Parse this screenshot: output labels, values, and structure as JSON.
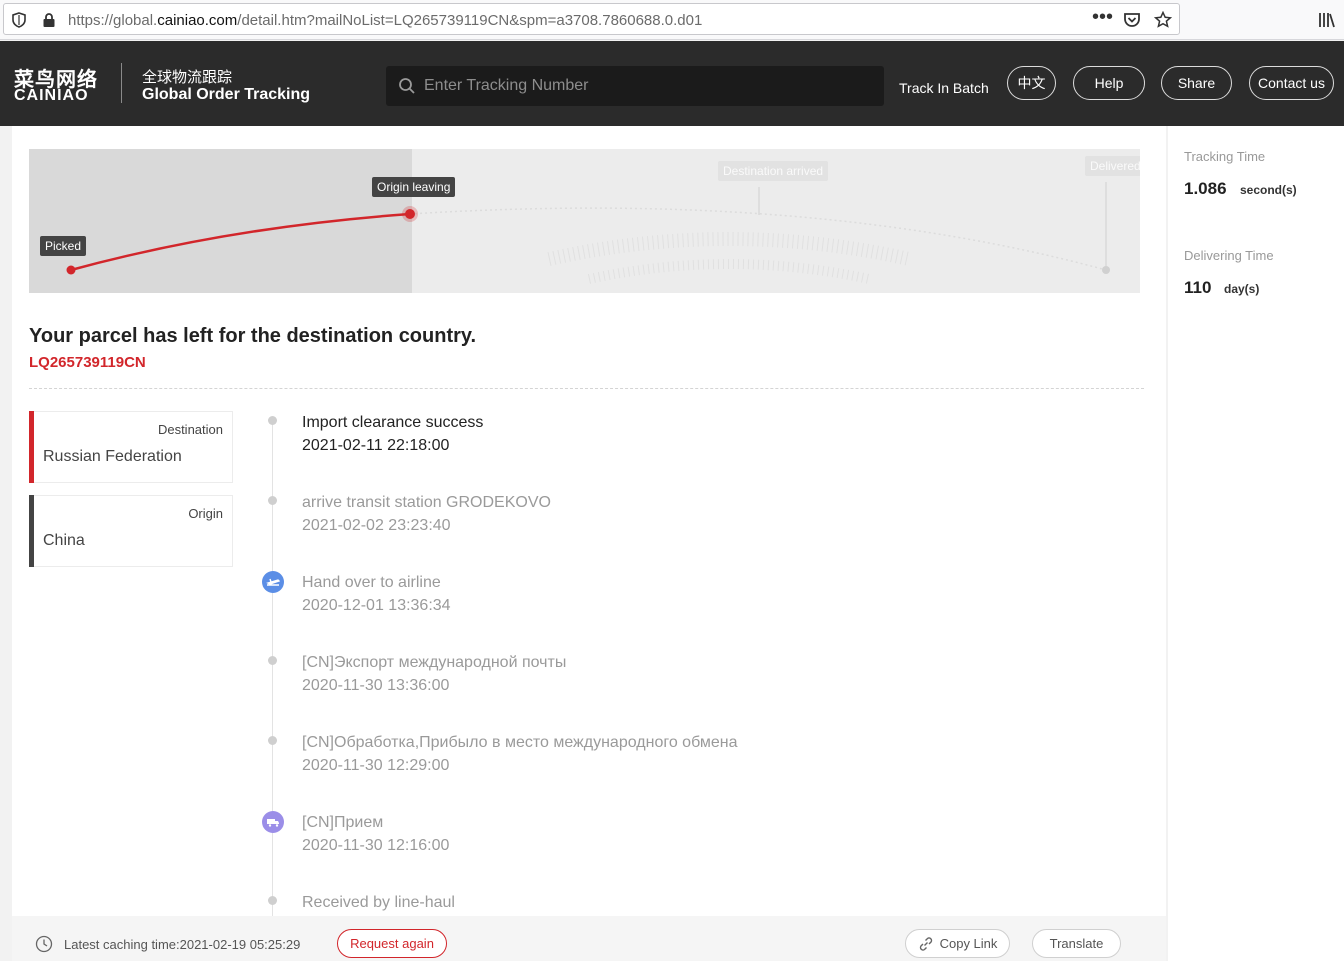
{
  "browser": {
    "url_prefix": "https://global.",
    "url_host": "cainiao.com",
    "url_path": "/detail.htm?mailNoList=LQ265739119CN&spm=a3708.7860688.0.d01"
  },
  "header": {
    "logo_cn": "菜鸟网络",
    "logo_en": "CAINIAO",
    "brand_cn": "全球物流跟踪",
    "brand_en": "Global Order Tracking",
    "search_placeholder": "Enter Tracking Number",
    "track_in_batch": "Track In Batch",
    "lang_button": "中文",
    "help_button": "Help",
    "share_button": "Share",
    "contact_button": "Contact us"
  },
  "progress_map": {
    "stages": [
      "Picked",
      "Origin leaving",
      "Destination arrived",
      "Delivered"
    ],
    "current_stage": "Origin leaving",
    "accent_color": "#d2262b"
  },
  "parcel": {
    "status_title": "Your parcel has left for the destination country.",
    "tracking_number": "LQ265739119CN"
  },
  "locations": {
    "destination_label": "Destination",
    "destination_value": "Russian Federation",
    "origin_label": "Origin",
    "origin_value": "China"
  },
  "timeline": [
    {
      "title": "Import clearance success",
      "time": "2021-02-11 22:18:00",
      "icon": "dot"
    },
    {
      "title": "arrive transit station GRODEKOVO",
      "time": "2021-02-02 23:23:40",
      "icon": "dot"
    },
    {
      "title": "Hand over to airline",
      "time": "2020-12-01 13:36:34",
      "icon": "airplane-icon"
    },
    {
      "title": "[CN]Экспорт международной почты",
      "time": "2020-11-30 13:36:00",
      "icon": "dot"
    },
    {
      "title": "[CN]Обработка,Прибыло в место международного обмена",
      "time": "2020-11-30 12:29:00",
      "icon": "dot"
    },
    {
      "title": "[CN]Прием",
      "time": "2020-11-30 12:16:00",
      "icon": "truck-icon"
    },
    {
      "title": "Received by line-haul",
      "time": "",
      "icon": "dot"
    }
  ],
  "footer": {
    "cache_text": "Latest caching time:2021-02-19 05:25:29",
    "request_again": "Request again",
    "copy_link": "Copy Link",
    "translate": "Translate"
  },
  "side": {
    "tracking_time_label": "Tracking Time",
    "tracking_time_value": "1.086",
    "tracking_time_unit": "second(s)",
    "delivering_time_label": "Delivering Time",
    "delivering_time_value": "110",
    "delivering_time_unit": "day(s)"
  }
}
